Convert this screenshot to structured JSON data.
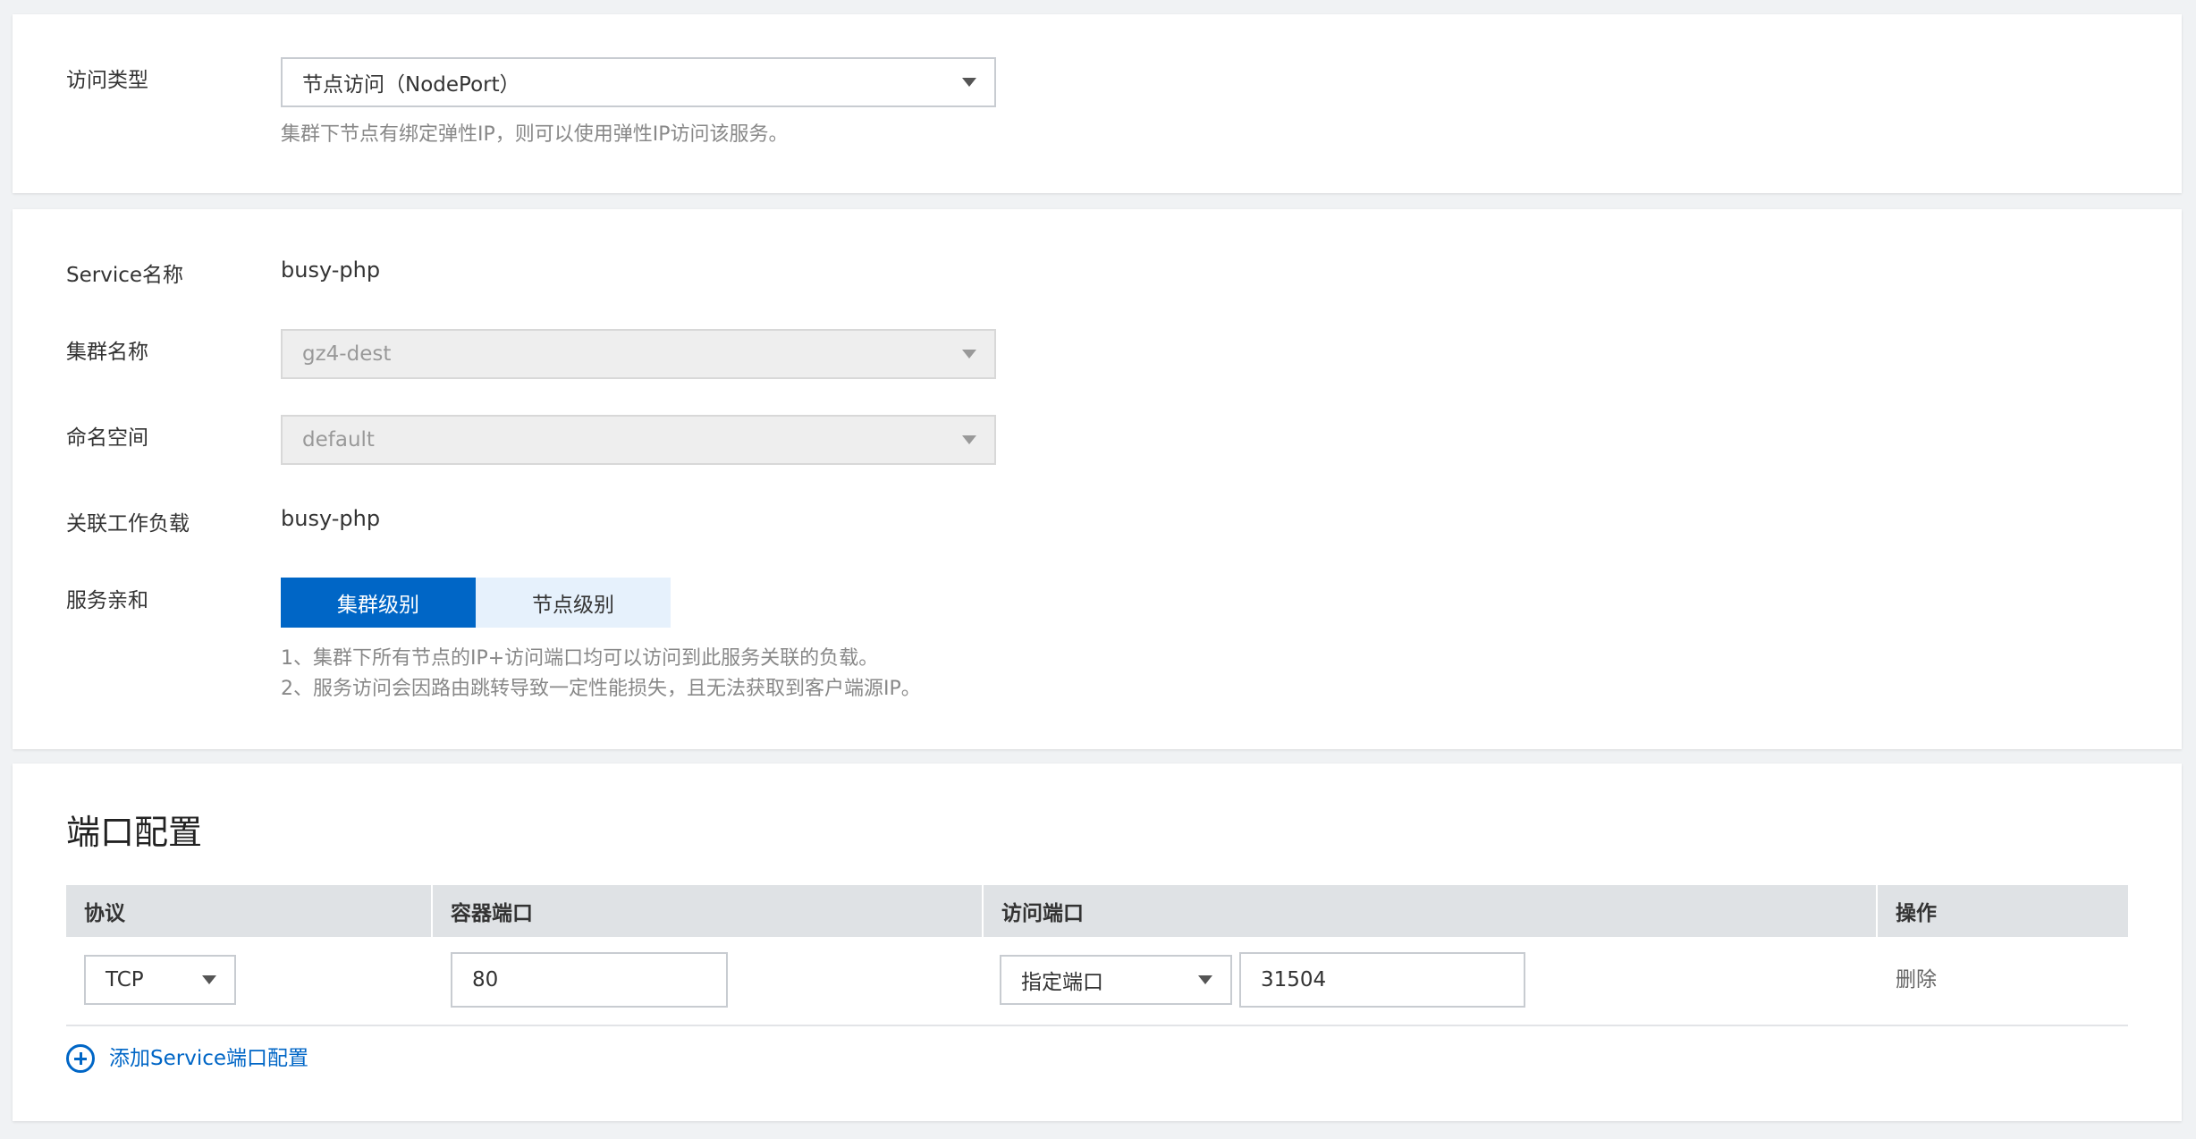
{
  "access": {
    "label": "访问类型",
    "selected": "节点访问（NodePort）",
    "hint": "集群下节点有绑定弹性IP，则可以使用弹性IP访问该服务。"
  },
  "service": {
    "name_label": "Service名称",
    "name_value": "busy-php",
    "cluster_label": "集群名称",
    "cluster_value": "gz4-dest",
    "namespace_label": "命名空间",
    "namespace_value": "default",
    "workload_label": "关联工作负载",
    "workload_value": "busy-php",
    "affinity_label": "服务亲和",
    "affinity_options": [
      "集群级别",
      "节点级别"
    ],
    "affinity_selected": "集群级别",
    "affinity_hints": [
      "1、集群下所有节点的IP+访问端口均可以访问到此服务关联的负载。",
      "2、服务访问会因路由跳转导致一定性能损失，且无法获取到客户端源IP。"
    ]
  },
  "ports": {
    "title": "端口配置",
    "columns": [
      "协议",
      "容器端口",
      "访问端口",
      "操作"
    ],
    "rows": [
      {
        "protocol": "TCP",
        "container_port": "80",
        "access_port_mode": "指定端口",
        "access_port": "31504",
        "action": "删除"
      }
    ],
    "add_label": "添加Service端口配置"
  },
  "colors": {
    "primary": "#0066c6",
    "segment_inactive": "#e6f1fc",
    "table_header": "#dfe2e5",
    "page_background": "#f0f2f4"
  },
  "icons": {
    "dropdown": "caret-down-icon",
    "add": "plus-circle-icon"
  }
}
